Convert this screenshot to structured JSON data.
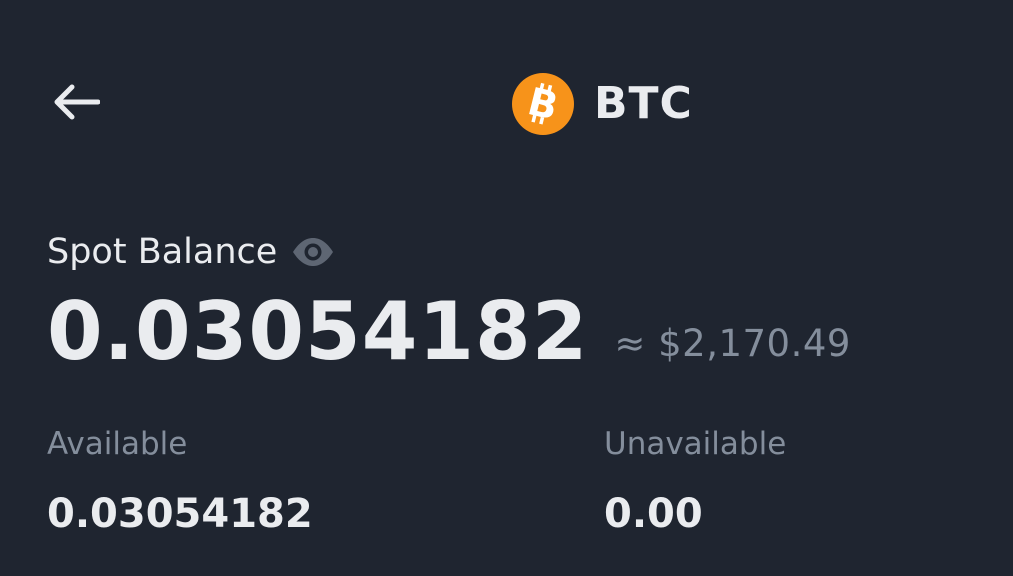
{
  "header": {
    "back_icon": "arrow-left-icon",
    "coin_icon": "bitcoin-icon",
    "coin_symbol": "BTC",
    "coin_color": "#f7931a"
  },
  "balance": {
    "label": "Spot Balance",
    "visibility_icon": "eye-icon",
    "amount": "0.03054182",
    "fiat_equivalent": "≈ $2,170.49"
  },
  "details": {
    "available_label": "Available",
    "available_value": "0.03054182",
    "unavailable_label": "Unavailable",
    "unavailable_value": "0.00"
  },
  "colors": {
    "background": "#1f2530",
    "primary_text": "#eaecef",
    "secondary_text": "#848e9c",
    "accent": "#f7931a"
  }
}
